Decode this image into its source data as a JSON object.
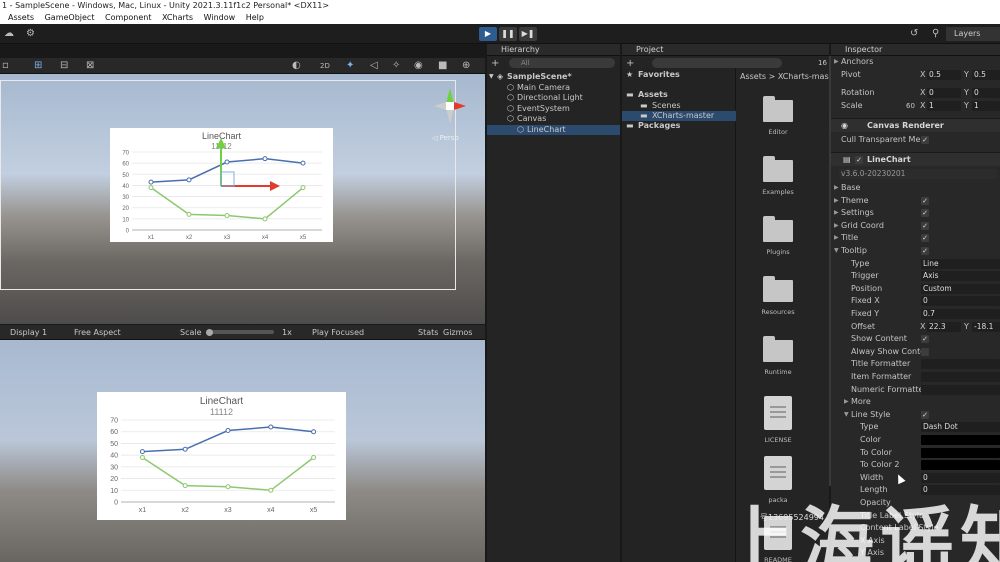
{
  "window": {
    "title": "1 - SampleScene - Windows, Mac, Linux - Unity 2021.3.11f1c2 Personal* <DX11>"
  },
  "menu": [
    "Assets",
    "GameObject",
    "Component",
    "XCharts",
    "Window",
    "Help"
  ],
  "toolbar": {
    "play": "▶",
    "pause": "❚❚",
    "step": "▶❚",
    "layers": "Layers",
    "mode_2d": "2D"
  },
  "scene_chart": {
    "title": "LineChart",
    "subtitle": "11112",
    "yticks": [
      "70",
      "60",
      "50",
      "40",
      "30",
      "20",
      "10",
      "0"
    ],
    "xticks": [
      "x1",
      "x2",
      "x3",
      "x4",
      "x5"
    ],
    "persp": "◁ Persp"
  },
  "game_bar": {
    "display": "Display 1",
    "aspect": "Free Aspect",
    "scale_label": "Scale",
    "scale_value": "1x",
    "play_focused": "Play Focused",
    "stats": "Stats",
    "gizmos": "Gizmos"
  },
  "game_chart": {
    "title": "LineChart",
    "subtitle": "11112",
    "yticks": [
      "70",
      "60",
      "50",
      "40",
      "30",
      "20",
      "10",
      "0"
    ],
    "xticks": [
      "x1",
      "x2",
      "x3",
      "x4",
      "x5"
    ]
  },
  "chart_data": {
    "type": "line",
    "categories": [
      "x1",
      "x2",
      "x3",
      "x4",
      "x5"
    ],
    "ylim": [
      0,
      70
    ],
    "grid": true,
    "series": [
      {
        "values": [
          43,
          45,
          61,
          64,
          60
        ],
        "color": "#4a6fb0"
      },
      {
        "values": [
          38,
          14,
          13,
          10,
          38
        ],
        "color": "#8dc86e"
      }
    ]
  },
  "hierarchy": {
    "title": "Hierarchy",
    "search_placeholder": "All",
    "items": [
      {
        "label": "SampleScene*",
        "depth": 0
      },
      {
        "label": "Main Camera",
        "depth": 1
      },
      {
        "label": "Directional Light",
        "depth": 1
      },
      {
        "label": "EventSystem",
        "depth": 1
      },
      {
        "label": "Canvas",
        "depth": 1
      },
      {
        "label": "LineChart",
        "depth": 2
      }
    ]
  },
  "project": {
    "title": "Project",
    "count": "16",
    "breadcrumb": "Assets > XCharts-master",
    "tree": [
      {
        "label": "Favorites",
        "depth": 0
      },
      {
        "label": "Assets",
        "depth": 0
      },
      {
        "label": "Scenes",
        "depth": 1
      },
      {
        "label": "XCharts-master",
        "depth": 1
      },
      {
        "label": "Packages",
        "depth": 0
      }
    ],
    "assets": [
      {
        "label": "Editor",
        "kind": "folder"
      },
      {
        "label": "Examples",
        "kind": "folder"
      },
      {
        "label": "Plugins",
        "kind": "folder"
      },
      {
        "label": "Resources",
        "kind": "folder"
      },
      {
        "label": "Runtime",
        "kind": "folder"
      },
      {
        "label": "LICENSE",
        "kind": "doc"
      },
      {
        "label": "packa",
        "kind": "doc"
      },
      {
        "label": "README",
        "kind": "doc"
      }
    ]
  },
  "inspector": {
    "title": "Inspector",
    "anchors": "Anchors",
    "pivot": {
      "label": "Pivot",
      "x_label": "X",
      "x": "0.5",
      "y_label": "Y",
      "y": "0.5"
    },
    "rotation": {
      "label": "Rotation",
      "x_label": "X",
      "x": "0",
      "y_label": "Y",
      "y": "0"
    },
    "scale": {
      "label": "Scale",
      "prefix": "60",
      "x_label": "X",
      "x": "1",
      "y_label": "Y",
      "y": "1"
    },
    "canvas_renderer": "Canvas Renderer",
    "cull": "Cull Transparent Me",
    "component": "LineChart",
    "version": "v3.6.0-20230201",
    "rows": [
      {
        "label": "Base",
        "type": "fold"
      },
      {
        "label": "Theme",
        "type": "check"
      },
      {
        "label": "Settings",
        "type": "check"
      },
      {
        "label": "Grid Coord",
        "type": "check"
      },
      {
        "label": "Title",
        "type": "check"
      },
      {
        "label": "Tooltip",
        "type": "check"
      },
      {
        "label": "Type",
        "type": "value",
        "value": "Line"
      },
      {
        "label": "Trigger",
        "type": "value",
        "value": "Axis"
      },
      {
        "label": "Position",
        "type": "value",
        "value": "Custom"
      },
      {
        "label": "Fixed X",
        "type": "value",
        "value": "0"
      },
      {
        "label": "Fixed Y",
        "type": "value",
        "value": "0.7"
      },
      {
        "label": "Offset",
        "type": "xy",
        "x_label": "X",
        "x": "22.3",
        "y_label": "Y",
        "y": "-18.1"
      },
      {
        "label": "Show Content",
        "type": "check"
      },
      {
        "label": "Alway Show Conte",
        "type": "check-empty"
      },
      {
        "label": "Title Formatter",
        "type": "value",
        "value": ""
      },
      {
        "label": "Item Formatter",
        "type": "value",
        "value": ""
      },
      {
        "label": "Numeric Formatter",
        "type": "value",
        "value": ""
      },
      {
        "label": "More",
        "type": "fold"
      },
      {
        "label": "Line Style",
        "type": "check"
      },
      {
        "label": "Type",
        "type": "value",
        "value": "Dash Dot"
      },
      {
        "label": "Color",
        "type": "color"
      },
      {
        "label": "To Color",
        "type": "color"
      },
      {
        "label": "To Color 2",
        "type": "color"
      },
      {
        "label": "Width",
        "type": "value",
        "value": "0"
      },
      {
        "label": "Length",
        "type": "value",
        "value": "0"
      },
      {
        "label": "Opacity",
        "type": "plain"
      },
      {
        "label": "Title Label Style",
        "type": "plain"
      },
      {
        "label": "Content Label Style",
        "type": "plain"
      },
      {
        "label": "X Axis",
        "type": "plain"
      },
      {
        "label": "Y Axis",
        "type": "plain"
      },
      {
        "label": "Serie 0: Line",
        "type": "plain"
      }
    ]
  },
  "watermark": {
    "text": "上海谣知",
    "id": "号13695524994"
  }
}
